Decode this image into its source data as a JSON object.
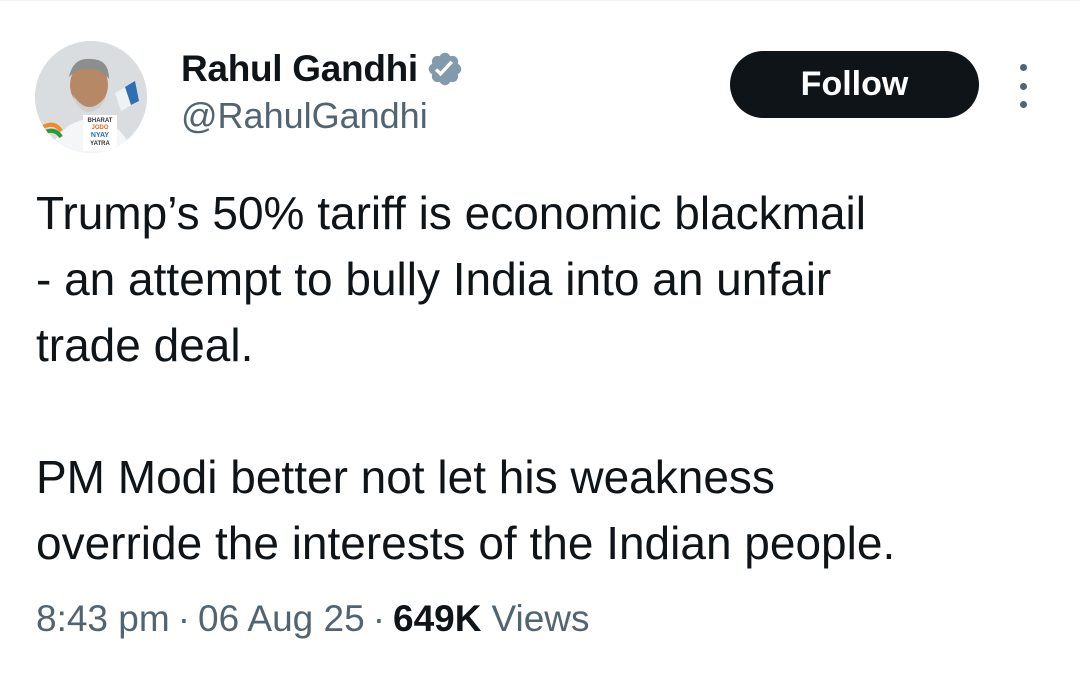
{
  "author": {
    "display_name": "Rahul Gandhi",
    "handle": "@RahulGandhi",
    "verified_badge_icon": "verified-badge-icon",
    "badge_color": "#829aab",
    "avatar_badge_text": [
      "BHARAT",
      "JODO",
      "NYAY",
      "YATRA"
    ]
  },
  "actions": {
    "follow_label": "Follow",
    "more_icon": "more-vertical-icon"
  },
  "tweet": {
    "paragraphs": [
      "Trump’s 50% tariff is economic blackmail\n- an attempt to bully India into an unfair\ntrade deal.",
      "PM Modi better not let his weakness\noverride the interests of the Indian people."
    ]
  },
  "meta": {
    "time": "8:43 pm",
    "separator": "·",
    "date": "06 Aug 25",
    "views_count": "649K",
    "views_label": "Views"
  },
  "colors": {
    "text_primary": "#0f1419",
    "text_secondary": "#536471",
    "follow_bg": "#0f1419",
    "follow_text": "#ffffff"
  }
}
